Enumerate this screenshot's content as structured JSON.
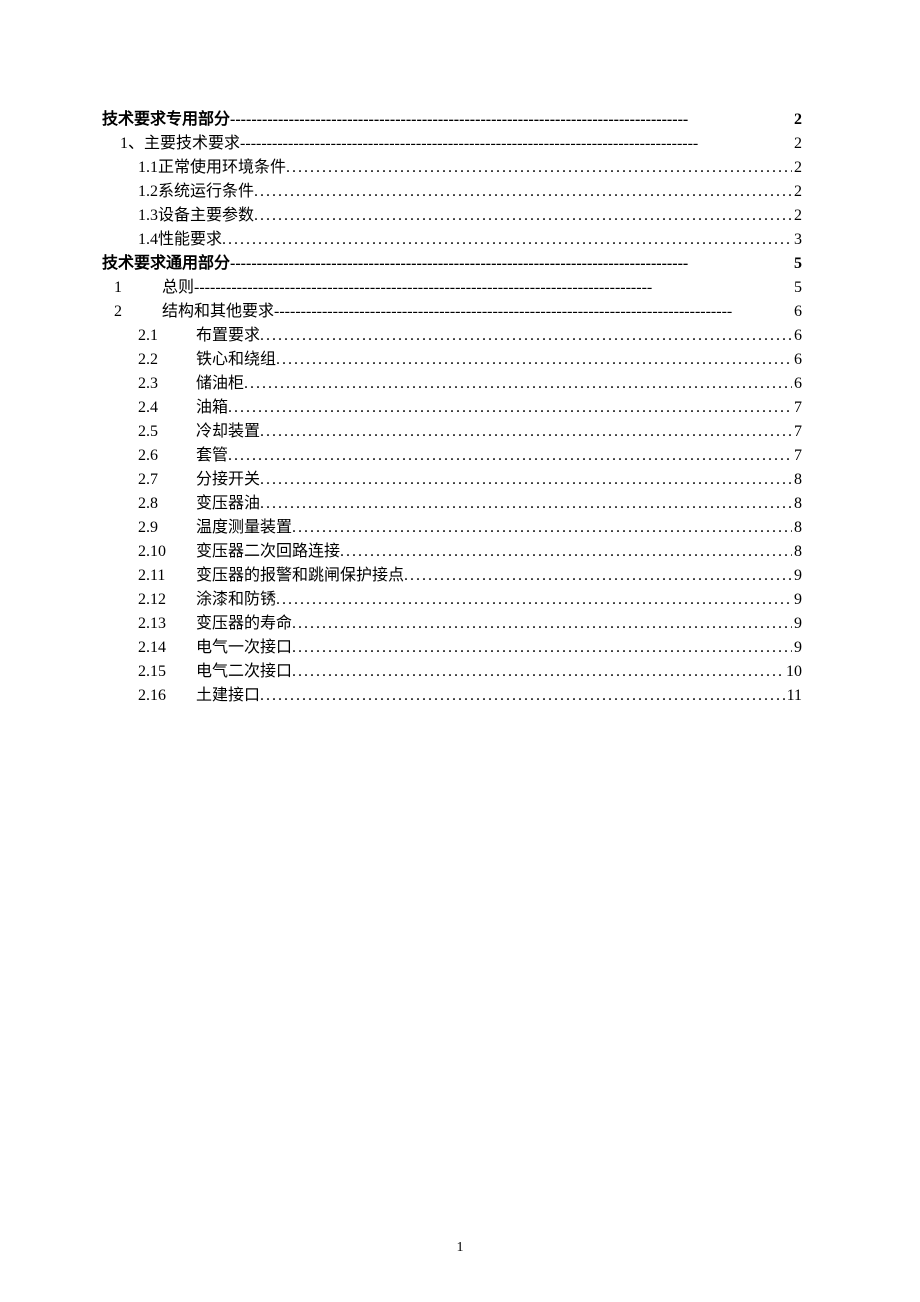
{
  "pageNumber": "1",
  "toc": [
    {
      "indent": "level0",
      "bold": true,
      "num": "",
      "title": "技术要求专用部分",
      "leader": "dashes",
      "page": "2"
    },
    {
      "indent": "level1",
      "bold": false,
      "num": "1、",
      "title": "主要技术要求",
      "leader": "dashes",
      "page": "2"
    },
    {
      "indent": "level2",
      "bold": false,
      "num": "1.1 ",
      "title": "正常使用环境条件",
      "leader": "dots",
      "page": "2"
    },
    {
      "indent": "level2",
      "bold": false,
      "num": "1.2 ",
      "title": "系统运行条件",
      "leader": "dots",
      "page": "2"
    },
    {
      "indent": "level2",
      "bold": false,
      "num": "1.3 ",
      "title": "设备主要参数",
      "leader": "dots",
      "page": "2"
    },
    {
      "indent": "level2",
      "bold": false,
      "num": "1.4 ",
      "title": "性能要求",
      "leader": "dots",
      "page": "3"
    },
    {
      "indent": "level0",
      "bold": true,
      "num": "",
      "title": "技术要求通用部分",
      "leader": "dashes",
      "page": "5"
    },
    {
      "indent": "level1b",
      "bold": false,
      "num": "1",
      "numcol": "num-col-a",
      "title": "总则",
      "leader": "dashes",
      "page": "5"
    },
    {
      "indent": "level1b",
      "bold": false,
      "num": "2",
      "numcol": "num-col-a",
      "title": "结构和其他要求",
      "leader": "dashes",
      "page": "6"
    },
    {
      "indent": "level2b",
      "bold": false,
      "num": "2.1",
      "numcol": "num-col-b",
      "title": "布置要求",
      "leader": "dots",
      "page": "6"
    },
    {
      "indent": "level2b",
      "bold": false,
      "num": "2.2",
      "numcol": "num-col-b",
      "title": "铁心和绕组",
      "leader": "dots",
      "page": "6"
    },
    {
      "indent": "level2b",
      "bold": false,
      "num": "2.3",
      "numcol": "num-col-b",
      "title": "储油柜",
      "leader": "dots",
      "page": "6"
    },
    {
      "indent": "level2b",
      "bold": false,
      "num": "2.4",
      "numcol": "num-col-b",
      "title": "油箱",
      "leader": "dots",
      "page": "7"
    },
    {
      "indent": "level2b",
      "bold": false,
      "num": "2.5",
      "numcol": "num-col-b",
      "title": "冷却装置",
      "leader": "dots",
      "page": "7"
    },
    {
      "indent": "level2b",
      "bold": false,
      "num": "2.6",
      "numcol": "num-col-b",
      "title": "套管",
      "leader": "dots",
      "page": "7"
    },
    {
      "indent": "level2b",
      "bold": false,
      "num": "2.7",
      "numcol": "num-col-b",
      "title": "分接开关",
      "leader": "dots",
      "page": "8"
    },
    {
      "indent": "level2b",
      "bold": false,
      "num": "2.8",
      "numcol": "num-col-b",
      "title": "变压器油",
      "leader": "dots",
      "page": "8"
    },
    {
      "indent": "level2b",
      "bold": false,
      "num": "2.9",
      "numcol": "num-col-b",
      "title": "温度测量装置",
      "leader": "dots",
      "page": "8"
    },
    {
      "indent": "level2b",
      "bold": false,
      "num": "2.10",
      "numcol": "num-col-b",
      "title": "变压器二次回路连接",
      "leader": "dots",
      "page": "8"
    },
    {
      "indent": "level2b",
      "bold": false,
      "num": "2.11",
      "numcol": "num-col-b",
      "title": "变压器的报警和跳闸保护接点",
      "leader": "dots",
      "page": "9"
    },
    {
      "indent": "level2b",
      "bold": false,
      "num": "2.12",
      "numcol": "num-col-b",
      "title": "涂漆和防锈",
      "leader": "dots",
      "page": "9"
    },
    {
      "indent": "level2b",
      "bold": false,
      "num": "2.13",
      "numcol": "num-col-b",
      "title": "变压器的寿命",
      "leader": "dots",
      "page": "9"
    },
    {
      "indent": "level2b",
      "bold": false,
      "num": "2.14",
      "numcol": "num-col-b",
      "title": "电气一次接口",
      "leader": "dots",
      "page": "9"
    },
    {
      "indent": "level2b",
      "bold": false,
      "num": "2.15",
      "numcol": "num-col-b",
      "title": "电气二次接口",
      "leader": "dots",
      "page": "10"
    },
    {
      "indent": "level2b",
      "bold": false,
      "num": "2.16",
      "numcol": "num-col-b",
      "title": "土建接口",
      "leader": "dots",
      "page": "11"
    }
  ]
}
